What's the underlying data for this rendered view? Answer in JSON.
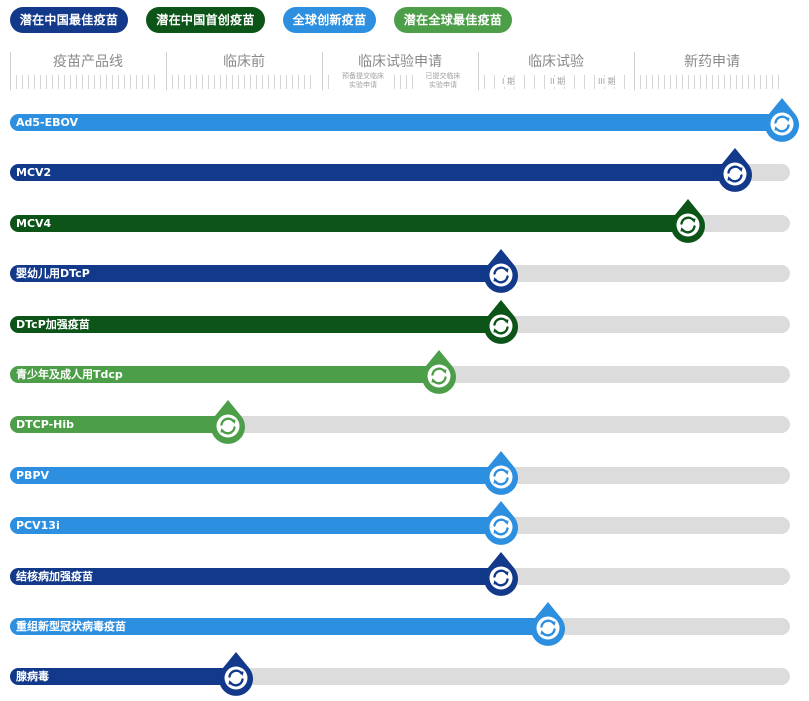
{
  "legend": [
    {
      "label": "潜在中国最佳疫苗",
      "color": "#12398a"
    },
    {
      "label": "潜在中国首创疫苗",
      "color": "#0d5418"
    },
    {
      "label": "全球创新疫苗",
      "color": "#2d8fe0"
    },
    {
      "label": "潜在全球最佳疫苗",
      "color": "#4d9e48"
    }
  ],
  "stages": {
    "labels": [
      "疫苗产品线",
      "临床前",
      "临床试验申请",
      "临床试验",
      "新药申请"
    ],
    "cta_sublabels": [
      "预备提交临床\n实验申请",
      "已提交临床\n实验申请"
    ],
    "trial_phases": [
      "I 期",
      "II 期",
      "III 期"
    ]
  },
  "chart_data": {
    "type": "bar",
    "orientation": "horizontal",
    "x_axis": "development stage (1 = start of 疫苗产品线 … 5 = end of 新药申请)",
    "xlim": [
      0,
      5
    ],
    "categories": [
      "Ad5-EBOV",
      "MCV2",
      "MCV4",
      "婴幼儿用DTcP",
      "DTcP加强疫苗",
      "青少年及成人用Tdcp",
      "DTCP-Hib",
      "PBPV",
      "PCV13i",
      "结核病加强疫苗",
      "重组新型冠状病毒疫苗",
      "腺病毒"
    ],
    "values": [
      5.0,
      4.7,
      4.4,
      3.2,
      3.2,
      2.8,
      1.45,
      3.2,
      3.2,
      3.2,
      3.5,
      1.5
    ],
    "colors": [
      "#2d8fe0",
      "#12398a",
      "#0d5418",
      "#12398a",
      "#0d5418",
      "#4d9e48",
      "#4d9e48",
      "#2d8fe0",
      "#2d8fe0",
      "#12398a",
      "#2d8fe0",
      "#12398a"
    ]
  }
}
